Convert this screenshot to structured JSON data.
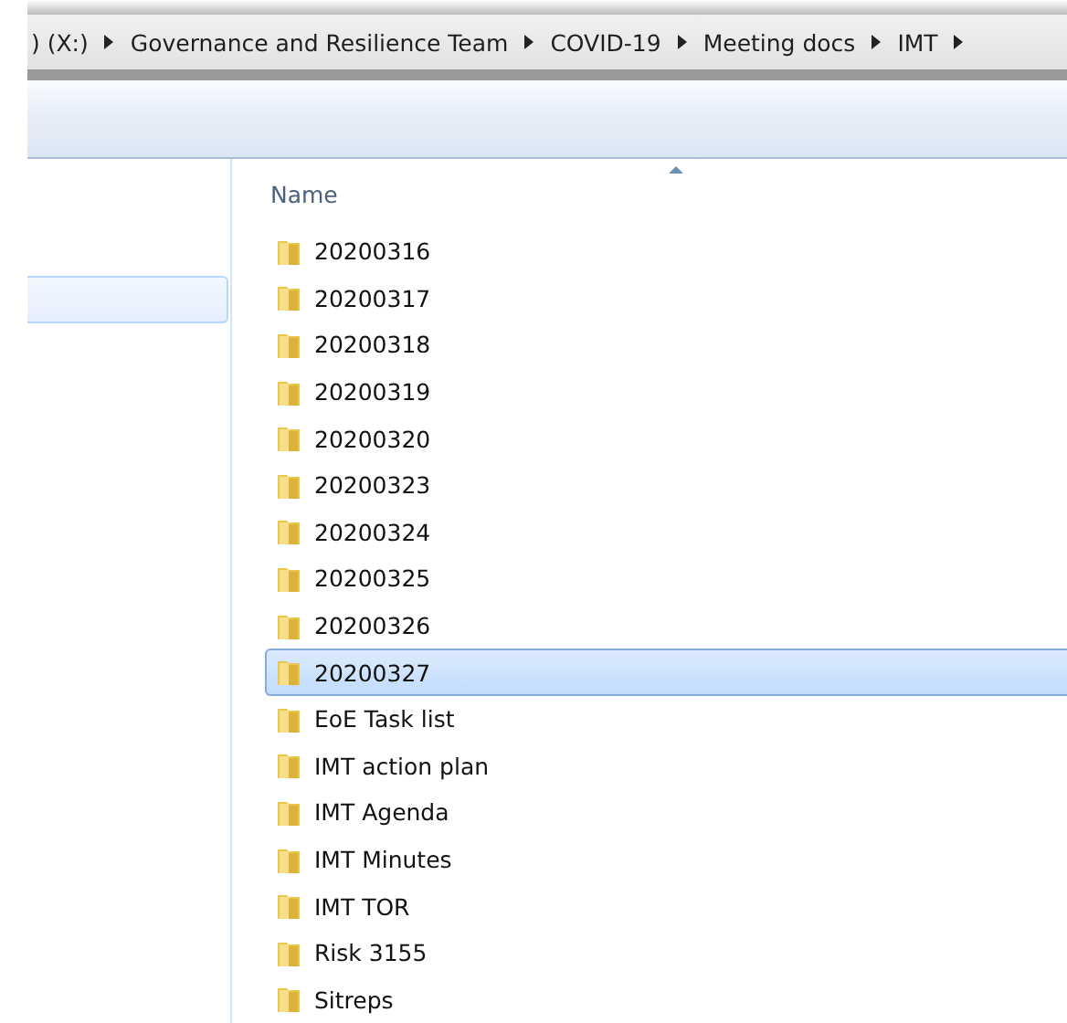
{
  "address_bar": {
    "crumbs": [
      ") (X:)",
      "Governance and Resilience Team",
      "COVID-19",
      "Meeting docs",
      "IMT"
    ]
  },
  "navigation_pane": {
    "items": [
      {
        "selected": true
      }
    ]
  },
  "file_list": {
    "columns": [
      {
        "label": "Name",
        "sorted": true
      }
    ],
    "rows": [
      {
        "name": "20200316",
        "selected": false
      },
      {
        "name": "20200317",
        "selected": false
      },
      {
        "name": "20200318",
        "selected": false
      },
      {
        "name": "20200319",
        "selected": false
      },
      {
        "name": "20200320",
        "selected": false
      },
      {
        "name": "20200323",
        "selected": false
      },
      {
        "name": "20200324",
        "selected": false
      },
      {
        "name": "20200325",
        "selected": false
      },
      {
        "name": "20200326",
        "selected": false
      },
      {
        "name": "20200327",
        "selected": true
      },
      {
        "name": "EoE Task list",
        "selected": false
      },
      {
        "name": "IMT action plan",
        "selected": false
      },
      {
        "name": "IMT Agenda",
        "selected": false
      },
      {
        "name": "IMT Minutes",
        "selected": false
      },
      {
        "name": "IMT TOR",
        "selected": false
      },
      {
        "name": "Risk 3155",
        "selected": false
      },
      {
        "name": "Sitreps",
        "selected": false
      }
    ]
  }
}
